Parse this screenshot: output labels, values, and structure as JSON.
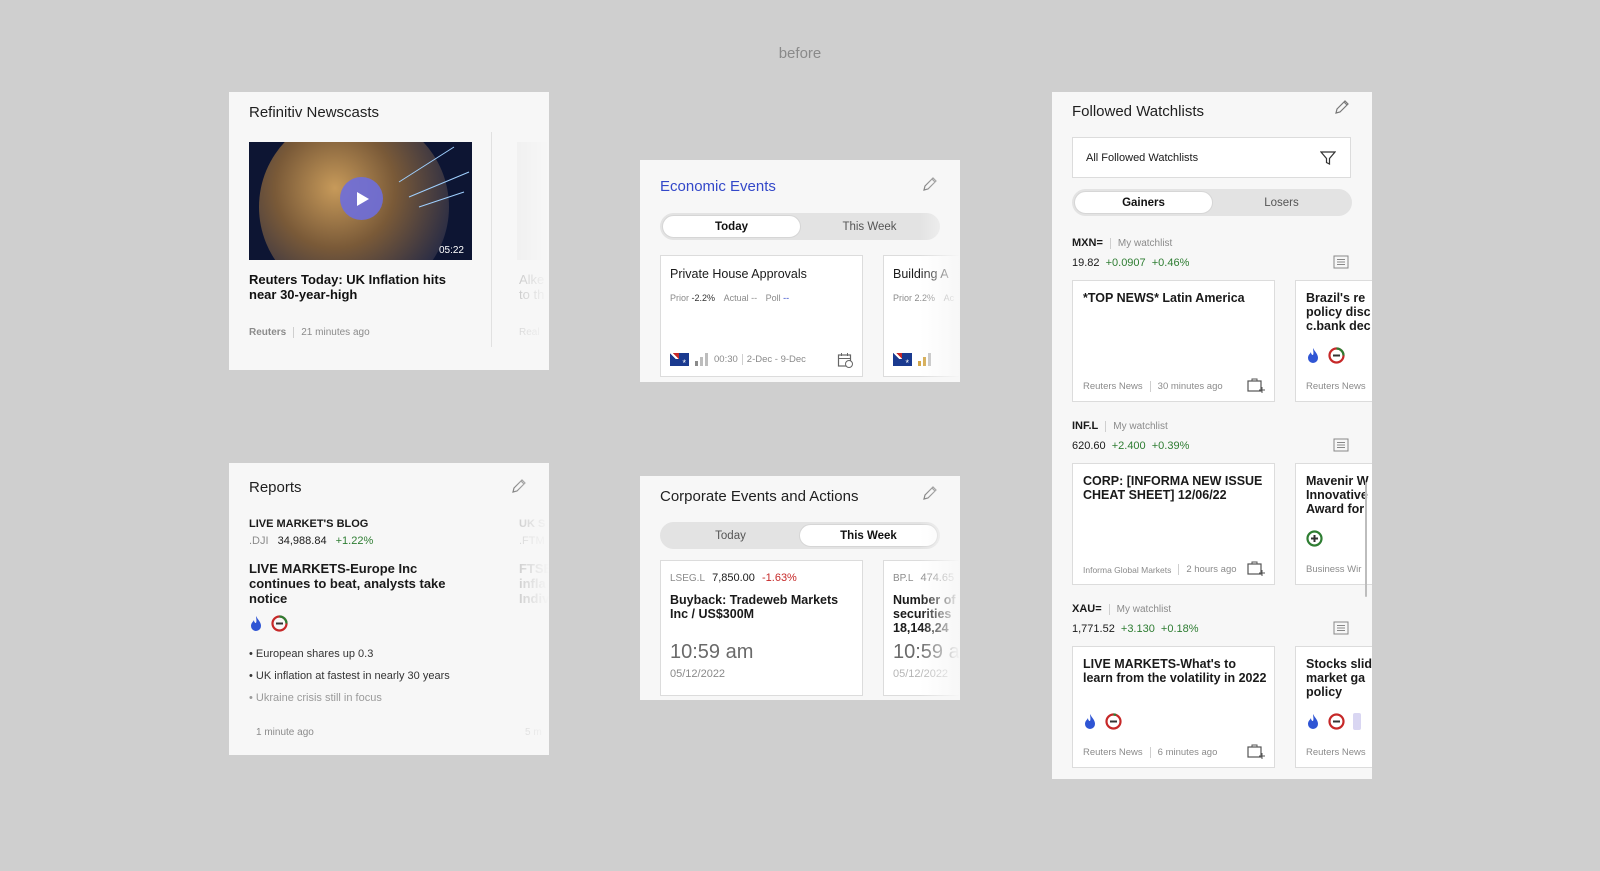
{
  "caption": "before",
  "newscasts": {
    "title": "Refinitiv Newscasts",
    "video_duration": "05:22",
    "headline": "Reuters Today: UK Inflation hits near 30-year-high",
    "source": "Reuters",
    "time": "21 minutes ago",
    "next_headline": "Alke",
    "next_headline_2": "to th",
    "next_source": "Real"
  },
  "reports": {
    "title": "Reports",
    "blog_label": "LIVE MARKET'S BLOG",
    "ric": ".DJI",
    "price": "34,988.84",
    "change": "+1.22%",
    "headline": "LIVE MARKETS-Europe Inc continues to beat, analysts take notice",
    "bullets": [
      "European shares up 0.3",
      "UK inflation at fastest in nearly 30 years",
      "Ukraine crisis still in focus"
    ],
    "time": "1 minute ago",
    "next_label": "UK S",
    "next_ric": ".FTM",
    "next_headline": "FTSE infla Indiv",
    "next_time": "5 m"
  },
  "economic": {
    "title": "Economic Events",
    "tabs": [
      "Today",
      "This Week"
    ],
    "card1": {
      "name": "Private House Approvals",
      "prior_label": "Prior",
      "prior": "-2.2%",
      "actual_label": "Actual",
      "actual": "--",
      "poll_label": "Poll",
      "poll": "--",
      "time": "00:30",
      "range": "2-Dec - 9-Dec"
    },
    "card2": {
      "name": "Building A",
      "prior_label": "Prior",
      "prior": "2.2%",
      "actual_label": "Ac"
    }
  },
  "corporate": {
    "title": "Corporate Events and Actions",
    "tabs": [
      "Today",
      "This Week"
    ],
    "card1": {
      "ric": "LSEG.L",
      "price": "7,850.00",
      "change": "-1.63%",
      "headline": "Buyback: Tradeweb Markets Inc / US$300M",
      "time": "10:59 am",
      "date": "05/12/2022"
    },
    "card2": {
      "ric": "BP.L",
      "price": "474.65",
      "headline": "Number of securities 18,148,24",
      "time": "10:59 a",
      "date": "05/12/2022"
    }
  },
  "watchlists": {
    "title": "Followed Watchlists",
    "filter_value": "All Followed Watchlists",
    "tabs": [
      "Gainers",
      "Losers"
    ],
    "items": [
      {
        "ric": "MXN=",
        "list": "My watchlist",
        "price": "19.82",
        "change": "+0.0907",
        "pct": "+0.46%",
        "news": [
          {
            "headline": "*TOP NEWS* Latin America",
            "source": "Reuters News",
            "time": "30 minutes ago"
          },
          {
            "headline": "Brazil's re policy disc c.bank dec",
            "source": "Reuters News"
          }
        ]
      },
      {
        "ric": "INF.L",
        "list": "My watchlist",
        "price": "620.60",
        "change": "+2.400",
        "pct": "+0.39%",
        "news": [
          {
            "headline": "CORP: [INFORMA NEW ISSUE CHEAT SHEET] 12/06/22",
            "source": "Informa Global Markets",
            "time": "2 hours ago"
          },
          {
            "headline": "Mavenir W Innovative Award for",
            "source": "Business Wir"
          }
        ]
      },
      {
        "ric": "XAU=",
        "list": "My watchlist",
        "price": "1,771.52",
        "change": "+3.130",
        "pct": "+0.18%",
        "news": [
          {
            "headline": "LIVE MARKETS-What's to learn from the volatility in 2022",
            "source": "Reuters News",
            "time": "6 minutes ago"
          },
          {
            "headline": "Stocks slid market ga policy",
            "source": "Reuters News"
          }
        ]
      }
    ]
  }
}
